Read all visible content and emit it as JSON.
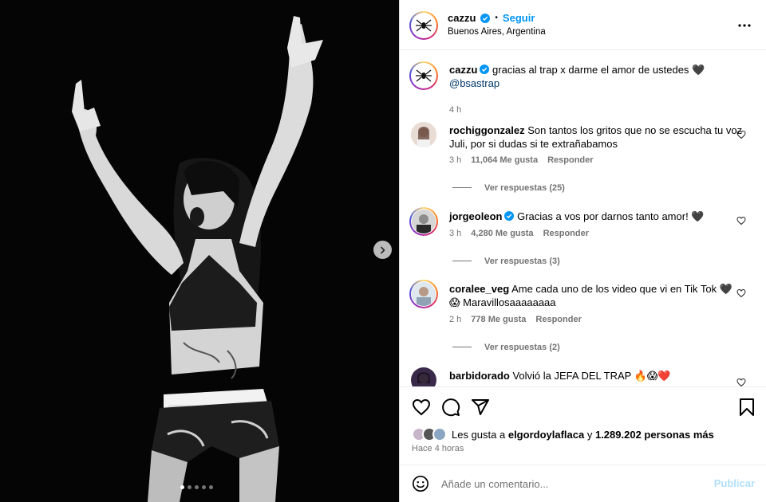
{
  "post": {
    "author": "cazzu",
    "follow_label": "Seguir",
    "separator": "•",
    "location": "Buenos Aires, Argentina",
    "more_icon": "more-horizontal-icon"
  },
  "caption": {
    "author": "cazzu",
    "text": "gracias al trap x darme el amor de ustedes 🖤",
    "mention": "@bsastrap",
    "time": "4 h"
  },
  "comments": [
    {
      "user": "rochiggonzalez",
      "verified": false,
      "text": "Son tantos los gritos que no se escucha tu voz Juli, por si dudas si te extrañabamos",
      "time": "3 h",
      "likes": "11,064 Me gusta",
      "reply_label": "Responder",
      "view_replies": "Ver respuestas (25)"
    },
    {
      "user": "jorgeoleon",
      "verified": true,
      "text": "Gracias a vos por darnos tanto amor! 🖤",
      "time": "3 h",
      "likes": "4,280 Me gusta",
      "reply_label": "Responder",
      "view_replies": "Ver respuestas (3)"
    },
    {
      "user": "coralee_veg",
      "verified": false,
      "text": "Ame cada uno de los video que vi en Tik Tok 🖤 😱 Maravillosaaaaaaaa",
      "time": "2 h",
      "likes": "778 Me gusta",
      "reply_label": "Responder",
      "view_replies": "Ver respuestas (2)"
    },
    {
      "user": "barbidorado",
      "verified": false,
      "text": "Volvió la JEFA DEL TRAP 🔥😱❤️"
    }
  ],
  "actions": {
    "likes_prefix": "Les gusta a",
    "likes_user": "elgordoylaflaca",
    "likes_joiner": "y",
    "likes_count": "1.289.202 personas más",
    "posted_ago": "Hace 4 horas"
  },
  "composer": {
    "placeholder": "Añade un comentario...",
    "publish_label": "Publicar"
  },
  "carousel": {
    "slides": 5,
    "active_index": 0
  },
  "colors": {
    "accent": "#0095f6",
    "verified": "#0095f6",
    "muted": "#737373",
    "publish_disabled": "#b2dffc",
    "mention": "#00376b"
  }
}
